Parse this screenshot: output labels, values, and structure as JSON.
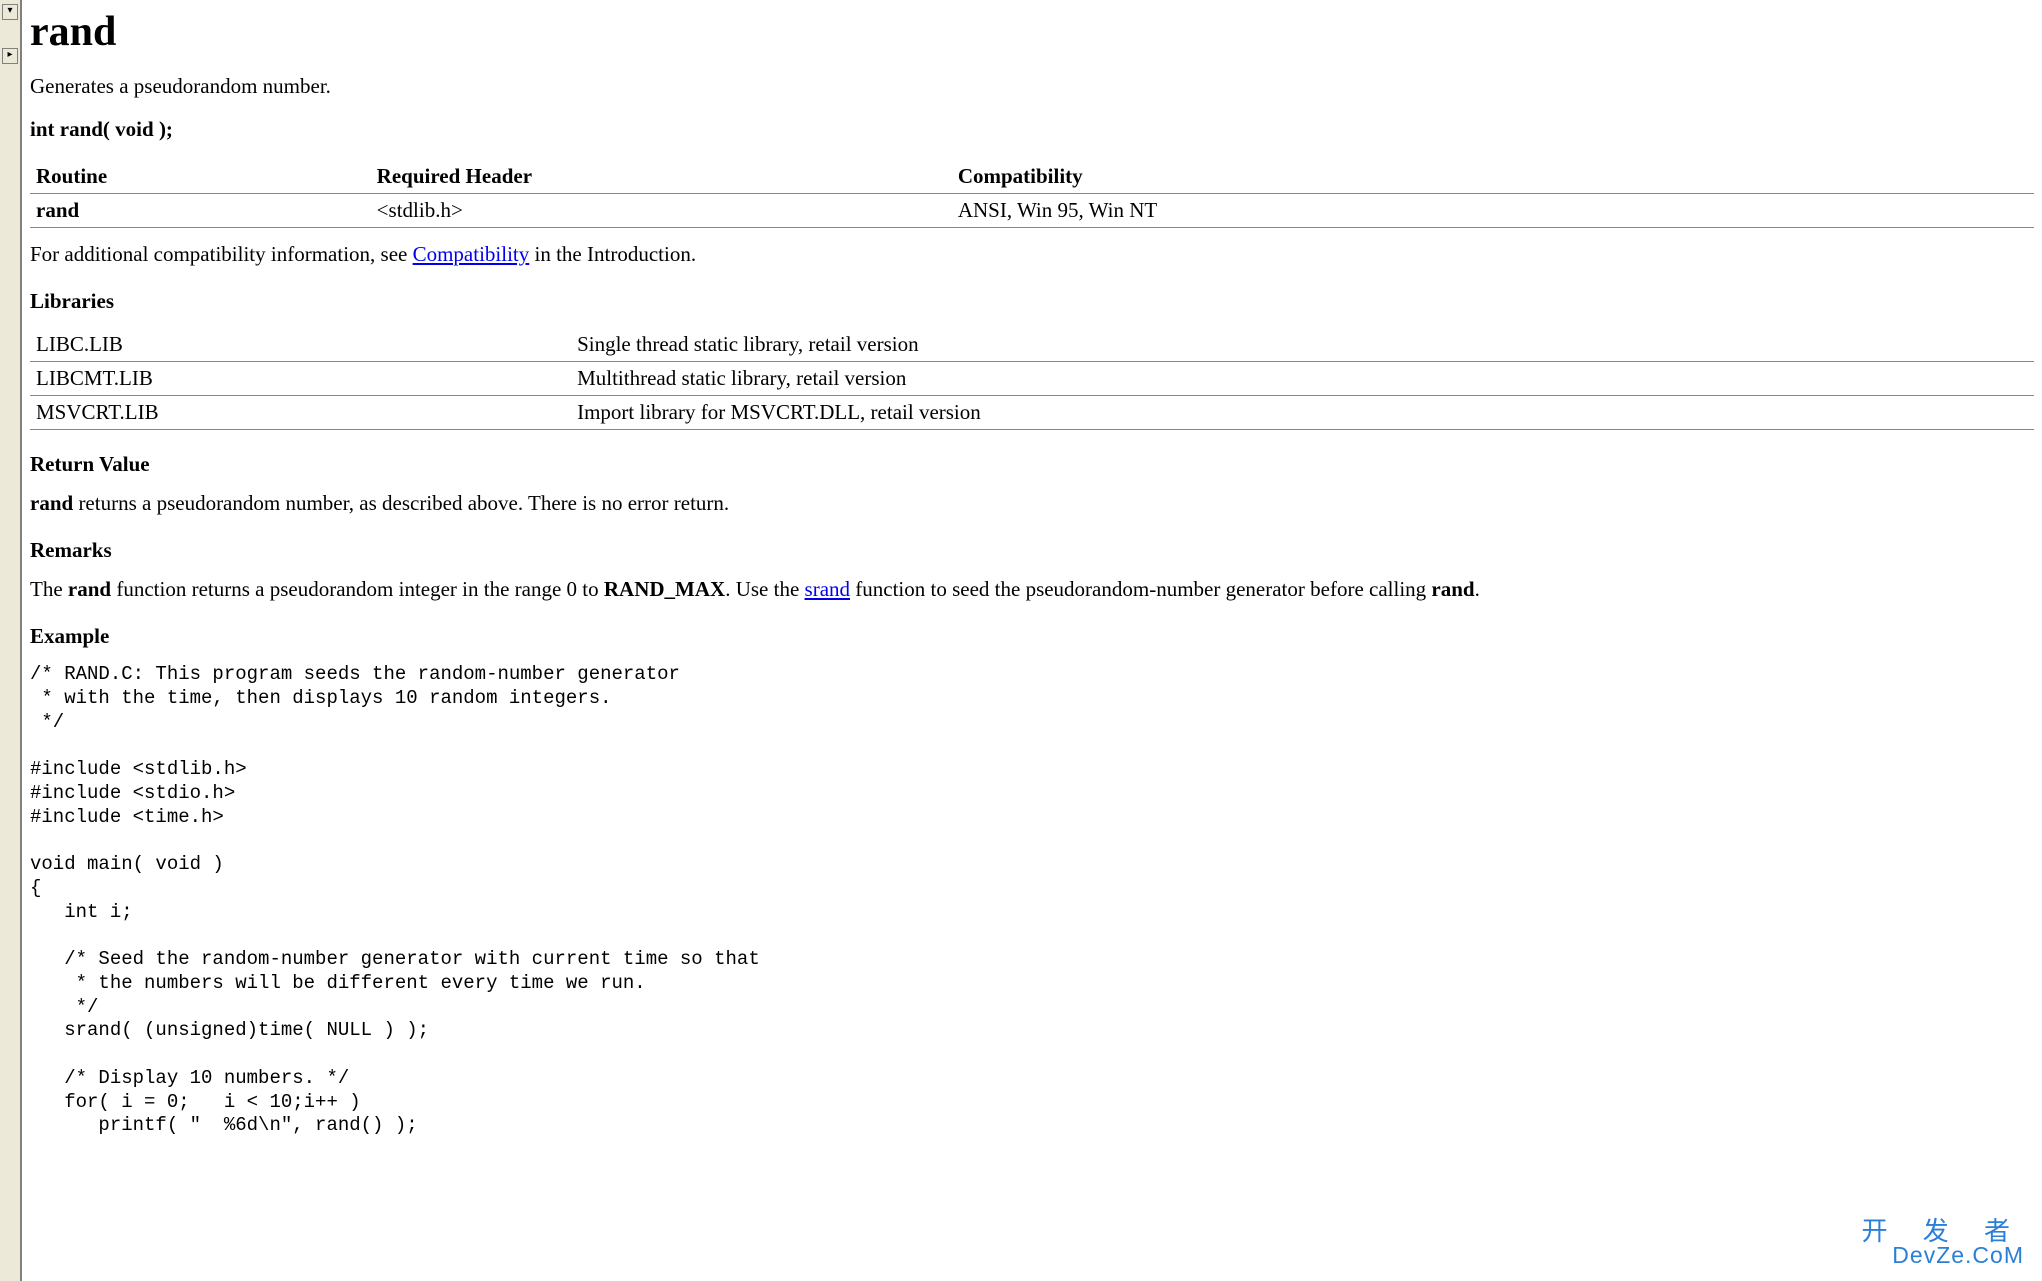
{
  "title": "rand",
  "summary": "Generates a pseudorandom number.",
  "signature": "int rand( void );",
  "compat_table": {
    "headers": [
      "Routine",
      "Required Header",
      "Compatibility"
    ],
    "rows": [
      [
        "rand",
        "<stdlib.h>",
        "ANSI, Win 95, Win NT"
      ]
    ]
  },
  "compat_note": {
    "prefix": "For additional compatibility information, see ",
    "link_text": "Compatibility",
    "suffix": " in the Introduction."
  },
  "libraries_heading": "Libraries",
  "libraries_table": {
    "rows": [
      [
        "LIBC.LIB",
        "Single thread static library, retail version"
      ],
      [
        "LIBCMT.LIB",
        "Multithread static library, retail version"
      ],
      [
        "MSVCRT.LIB",
        "Import library for MSVCRT.DLL, retail version"
      ]
    ]
  },
  "return_heading": "Return Value",
  "return_para": {
    "bold": "rand",
    "rest": " returns a pseudorandom number, as described above. There is no error return."
  },
  "remarks_heading": "Remarks",
  "remarks_para": {
    "t1": "The ",
    "b1": "rand",
    "t2": " function returns a pseudorandom integer in the range 0 to ",
    "b2": "RAND_MAX",
    "t3": ". Use the ",
    "link": "srand",
    "t4": " function to seed the pseudorandom-number generator before calling ",
    "b3": "rand",
    "t5": "."
  },
  "example_heading": "Example",
  "example_code": "/* RAND.C: This program seeds the random-number generator\n * with the time, then displays 10 random integers.\n */\n\n#include <stdlib.h>\n#include <stdio.h>\n#include <time.h>\n\nvoid main( void )\n{\n   int i;\n\n   /* Seed the random-number generator with current time so that\n    * the numbers will be different every time we run.\n    */\n   srand( (unsigned)time( NULL ) );\n\n   /* Display 10 numbers. */\n   for( i = 0;   i < 10;i++ )\n      printf( \"  %6d\\n\", rand() );",
  "watermark": {
    "line1": "开 发 者",
    "line2": "DevZe.CoM"
  },
  "rail": {
    "top_glyph": "▾",
    "mid_glyph": "▸"
  }
}
